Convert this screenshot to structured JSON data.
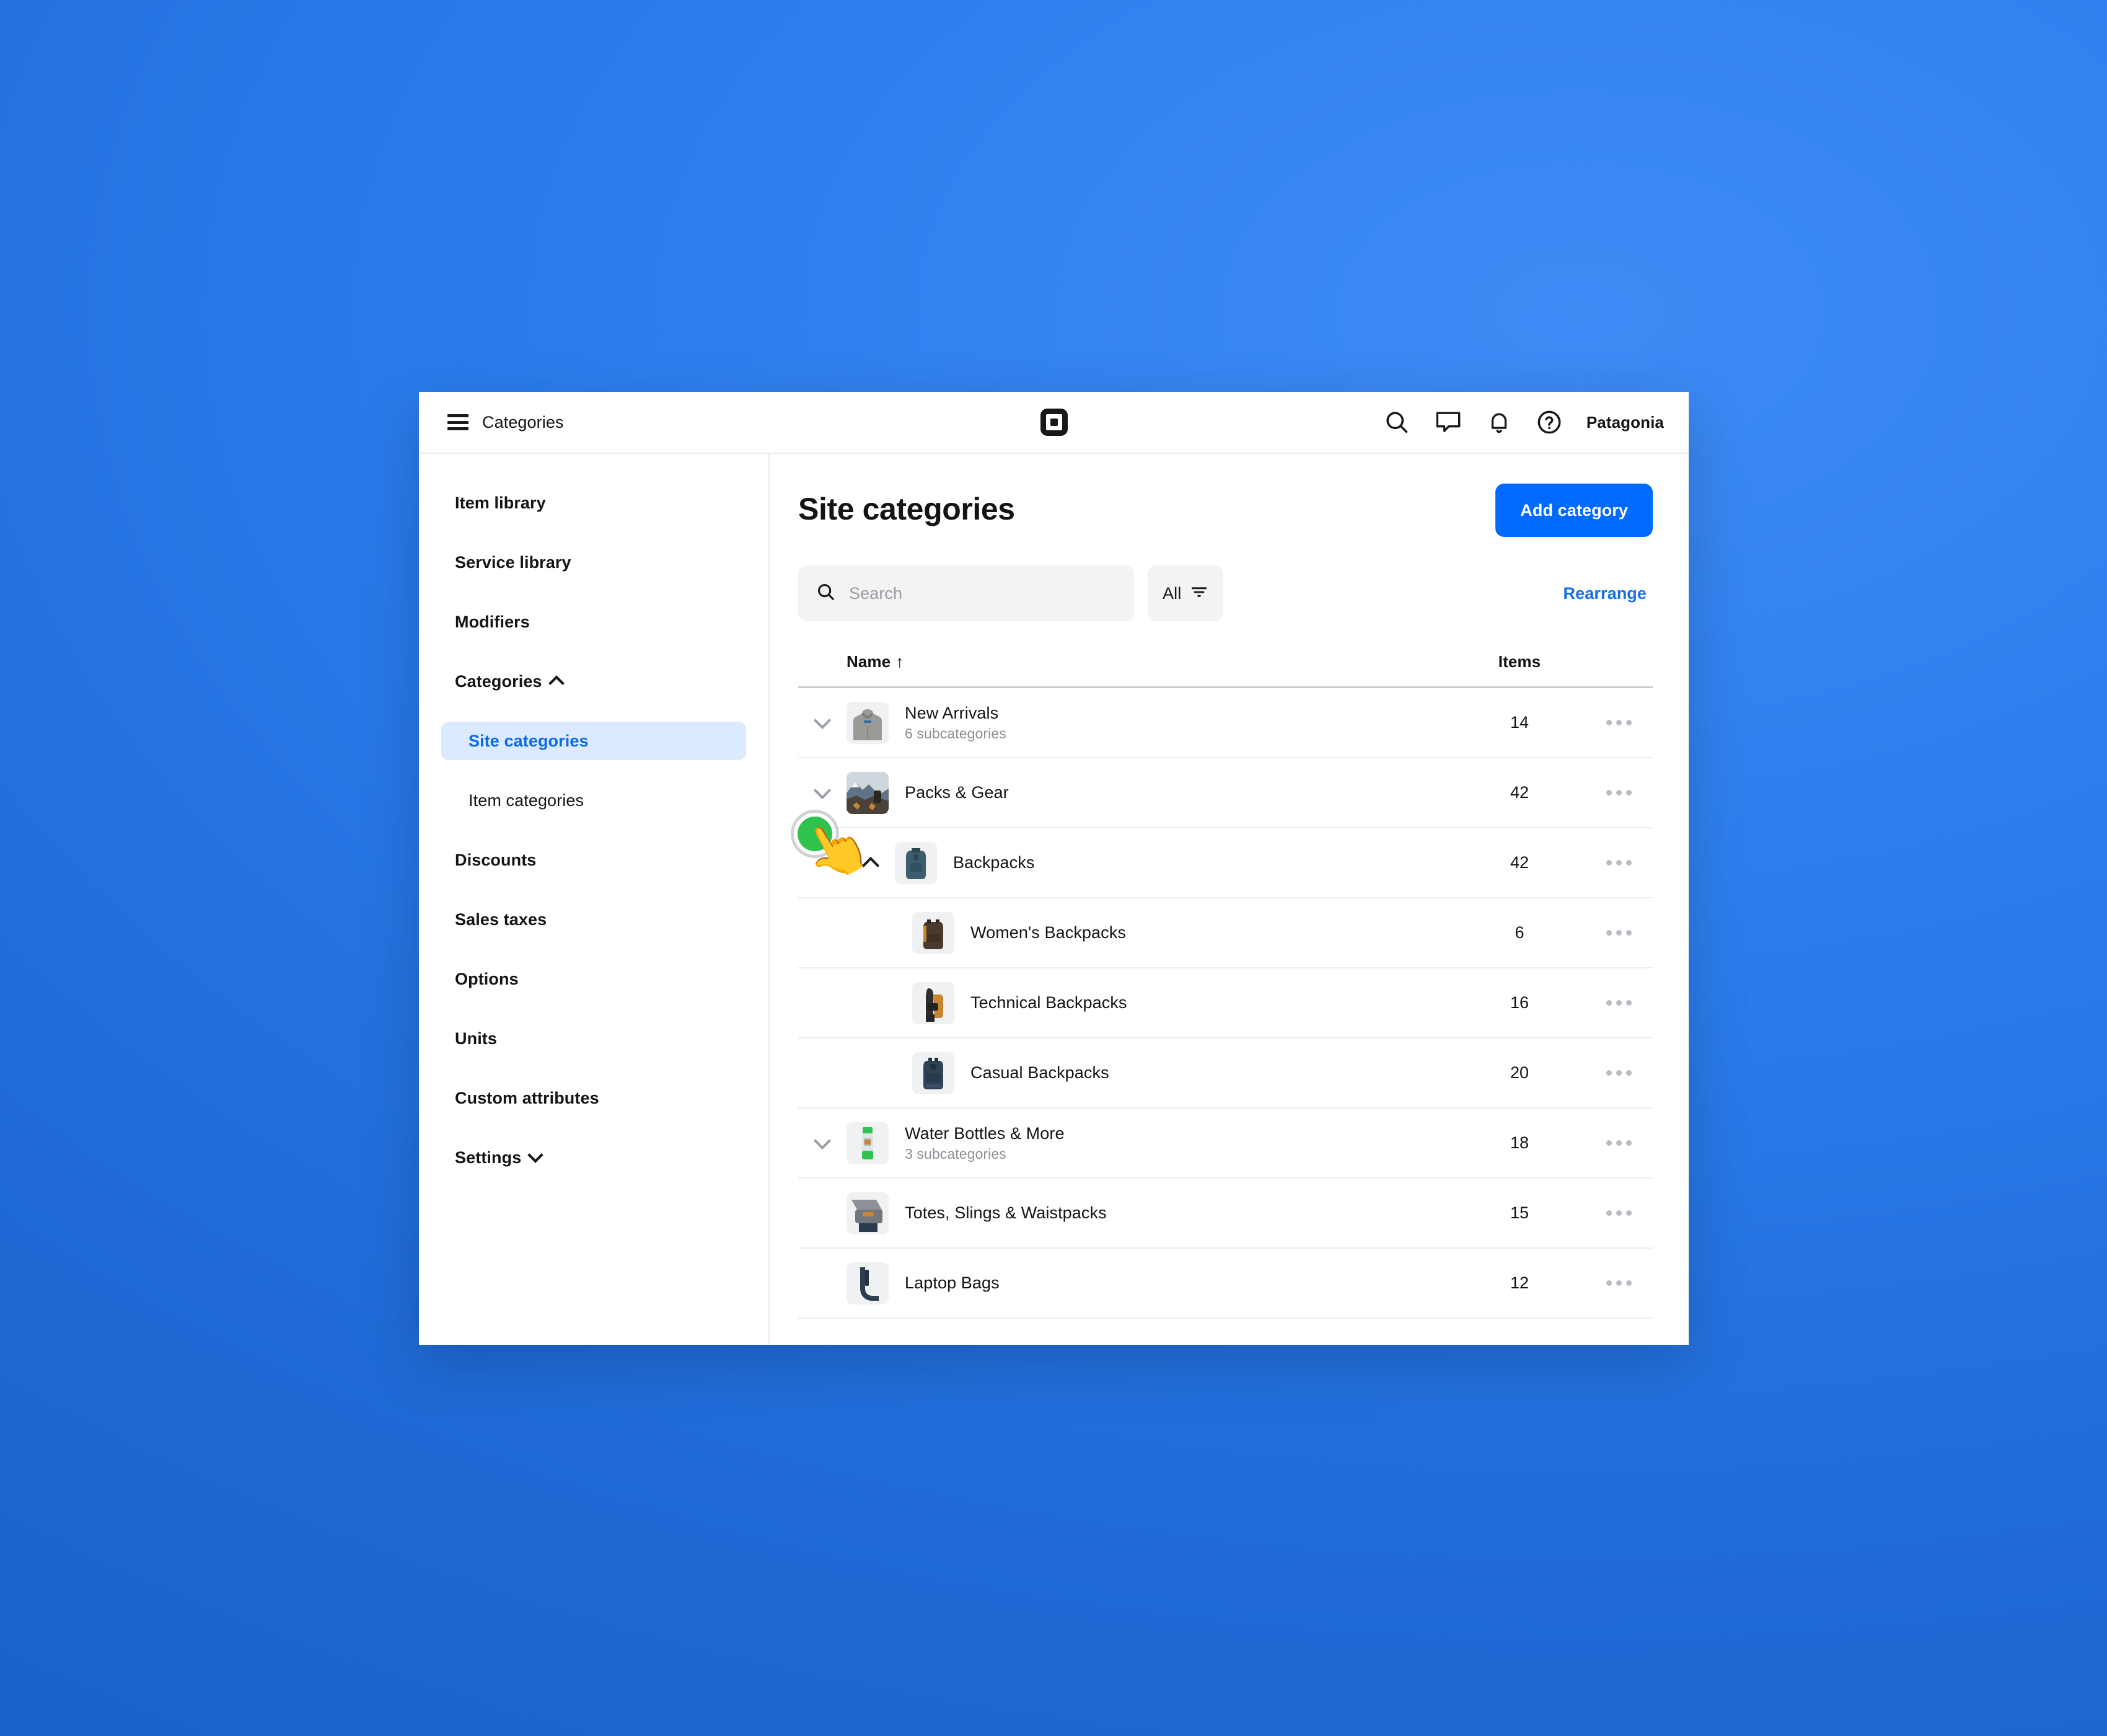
{
  "topbar": {
    "menu_icon": "hamburger-icon",
    "title": "Categories",
    "logo": "square-logo",
    "icons": [
      "search-icon",
      "messages-icon",
      "notifications-bell-icon",
      "help-circle-icon"
    ],
    "merchant": "Patagonia"
  },
  "sidebar": {
    "items": [
      {
        "label": "Item library",
        "type": "top",
        "active": false
      },
      {
        "label": "Service library",
        "type": "top",
        "active": false
      },
      {
        "label": "Modifiers",
        "type": "top",
        "active": false
      },
      {
        "label": "Categories",
        "type": "top",
        "active": false,
        "caret": "chevron-up"
      },
      {
        "label": "Site categories",
        "type": "sub",
        "active": true
      },
      {
        "label": "Item categories",
        "type": "sub",
        "active": false
      },
      {
        "label": "Discounts",
        "type": "top",
        "active": false
      },
      {
        "label": "Sales taxes",
        "type": "top",
        "active": false
      },
      {
        "label": "Options",
        "type": "top",
        "active": false
      },
      {
        "label": "Units",
        "type": "top",
        "active": false
      },
      {
        "label": "Custom attributes",
        "type": "top",
        "active": false
      },
      {
        "label": "Settings",
        "type": "top",
        "active": false,
        "caret": "chevron-down"
      }
    ]
  },
  "main": {
    "page_title": "Site categories",
    "add_button": "Add category",
    "search_placeholder": "Search",
    "search_value": "",
    "filter_chip": "All",
    "rearrange_link": "Rearrange",
    "table": {
      "columns": {
        "name": "Name",
        "sort_indicator": "↑",
        "items": "Items"
      },
      "rows": [
        {
          "name": "New Arrivals",
          "subtitle": "6 subcategories",
          "items": "14",
          "level": 0,
          "toggle": "chevron-down",
          "thumb": "hoodie-gray"
        },
        {
          "name": "Packs & Gear",
          "subtitle": "",
          "items": "42",
          "level": 0,
          "toggle": "chevron-down",
          "thumb": "mountain-scene"
        },
        {
          "name": "Backpacks",
          "subtitle": "",
          "items": "42",
          "level": 1,
          "toggle": "chevron-up",
          "thumb": "backpack-teal"
        },
        {
          "name": "Women's Backpacks",
          "subtitle": "",
          "items": "6",
          "level": 2,
          "toggle": "",
          "thumb": "backpack-brown"
        },
        {
          "name": "Technical Backpacks",
          "subtitle": "",
          "items": "16",
          "level": 2,
          "toggle": "",
          "thumb": "backpack-tan"
        },
        {
          "name": "Casual Backpacks",
          "subtitle": "",
          "items": "20",
          "level": 2,
          "toggle": "",
          "thumb": "backpack-navy"
        },
        {
          "name": "Water Bottles & More",
          "subtitle": "3 subcategories",
          "items": "18",
          "level": 0,
          "toggle": "chevron-down",
          "thumb": "water-bottle-green"
        },
        {
          "name": "Totes, Slings & Waistpacks",
          "subtitle": "",
          "items": "15",
          "level": 0,
          "toggle": "",
          "thumb": "tote-bag-gray"
        },
        {
          "name": "Laptop Bags",
          "subtitle": "",
          "items": "12",
          "level": 0,
          "toggle": "",
          "thumb": "laptop-bag-navy"
        }
      ]
    }
  },
  "cursor": {
    "type": "tap-indicator",
    "hand": "👆",
    "color": "#2fc24d"
  },
  "colors": {
    "accent_blue": "#006aff",
    "link_blue": "#1571e6",
    "active_bg": "#dbeafe",
    "desktop_bg": "#1d6fd4",
    "chip_bg": "#f3f3f4"
  }
}
